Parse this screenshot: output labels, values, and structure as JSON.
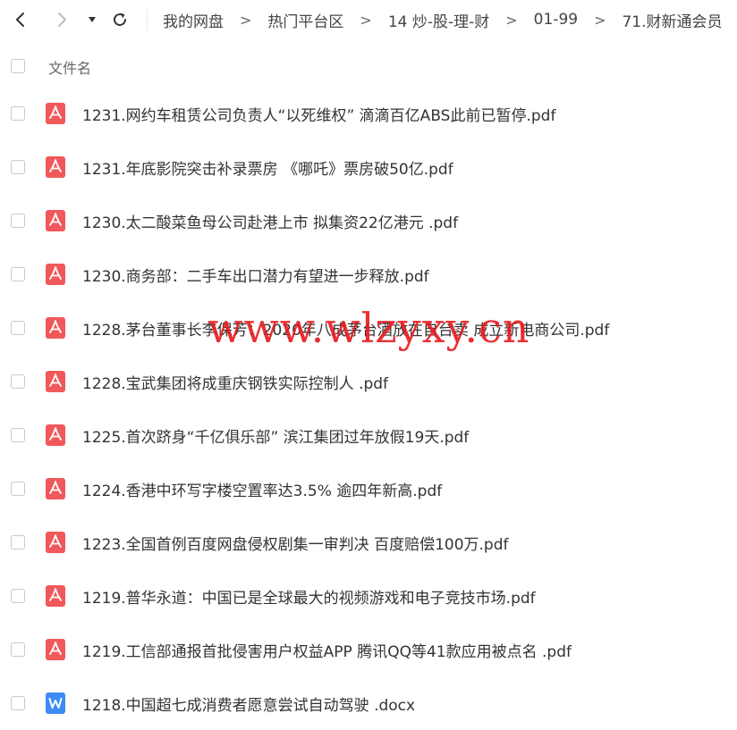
{
  "toolbar": {
    "icons": {
      "back": "chevron-left-icon",
      "forward": "chevron-right-icon",
      "dropdown": "caret-down-icon",
      "refresh": "refresh-icon"
    },
    "breadcrumb": [
      "我的网盘",
      "热门平台区",
      "14 炒-股-理-财",
      "01-99",
      "71.财新通会员"
    ],
    "separator": ">"
  },
  "list_header": {
    "name_label": "文件名"
  },
  "files": [
    {
      "name": "1231.网约车租赁公司负责人“以死维权” 滴滴百亿ABS此前已暂停.pdf",
      "type": "pdf"
    },
    {
      "name": "1231.年底影院突击补录票房 《哪吒》票房破50亿.pdf",
      "type": "pdf"
    },
    {
      "name": "1230.太二酸菜鱼母公司赴港上市 拟集资22亿港元 .pdf",
      "type": "pdf"
    },
    {
      "name": "1230.商务部：二手车出口潜力有望进一步释放.pdf",
      "type": "pdf"
    },
    {
      "name": "1228.茅台董事长李保芳：2020年八成茅台酒放在自台卖 成立新电商公司.pdf",
      "type": "pdf"
    },
    {
      "name": "1228.宝武集团将成重庆钢铁实际控制人 .pdf",
      "type": "pdf"
    },
    {
      "name": "1225.首次跻身“千亿俱乐部” 滨江集团过年放假19天.pdf",
      "type": "pdf"
    },
    {
      "name": "1224.香港中环写字楼空置率达3.5% 逾四年新高.pdf",
      "type": "pdf"
    },
    {
      "name": "1223.全国首例百度网盘侵权剧集一审判决 百度赔偿100万.pdf",
      "type": "pdf"
    },
    {
      "name": "1219.普华永道：中国已是全球最大的视频游戏和电子竞技市场.pdf",
      "type": "pdf"
    },
    {
      "name": "1219.工信部通报首批侵害用户权益APP 腾讯QQ等41款应用被点名 .pdf",
      "type": "pdf"
    },
    {
      "name": "1218.中国超七成消费者愿意尝试自动驾驶 .docx",
      "type": "docx"
    }
  ],
  "icon_colors": {
    "pdf": "#f0585b",
    "docx": "#3d8bf5"
  },
  "watermark": "www.wlzyxy.cn"
}
